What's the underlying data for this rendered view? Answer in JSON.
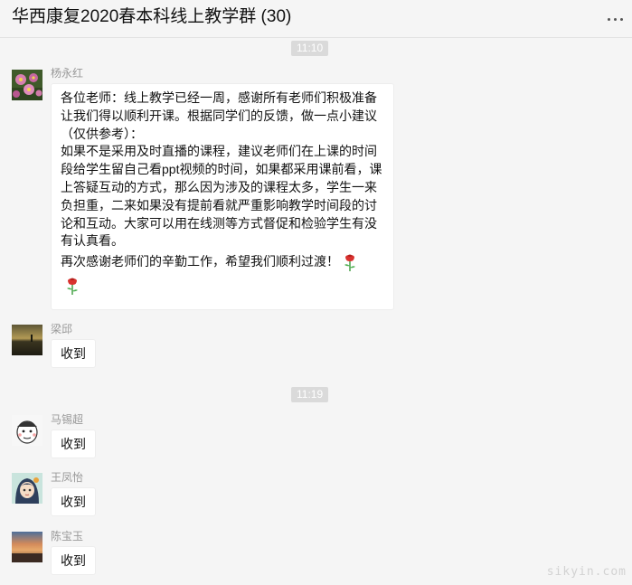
{
  "chat": {
    "title": "华西康复2020春本科线上教学群 (30)",
    "more_icon": "more-horizontal-icon"
  },
  "timestamps": [
    "11:10",
    "11:19"
  ],
  "messages": [
    {
      "sender": "杨永红",
      "avatar": "flower-photo-avatar",
      "lines": [
        "各位老师：线上教学已经一周，感谢所有老师们积极准备",
        "让我们得以顺利开课。根据同学们的反馈，做一点小建议",
        "（仅供参考）：",
        "如果不是采用及时直播的课程，建议老师们在上课的时间",
        "段给学生留自己看ppt视频的时间，如果都采用课前看，课",
        "上答疑互动的方式，那么因为涉及的课程太多，学生一来",
        "负担重，二来如果没有提前看就严重影响教学时间段的讨",
        "论和互动。大家可以用在线测等方式督促和检验学生有没",
        "有认真看。",
        "再次感谢老师们的辛勤工作，希望我们顺利过渡！"
      ],
      "emoji": "rose-emoji"
    },
    {
      "sender": "梁邱",
      "avatar": "sunset-field-avatar",
      "text": "收到"
    },
    {
      "sender": "马锡超",
      "avatar": "cartoon-face-avatar",
      "text": "收到"
    },
    {
      "sender": "王凤怡",
      "avatar": "anime-girl-avatar",
      "text": "收到"
    },
    {
      "sender": "陈宝玉",
      "avatar": "sunset-sky-avatar",
      "text": "收到"
    }
  ],
  "watermark": "sikyin.com",
  "colors": {
    "background": "#f5f5f5",
    "bubble": "#ffffff",
    "timestamp_pill": "#dadada",
    "sender_name": "#999999"
  }
}
